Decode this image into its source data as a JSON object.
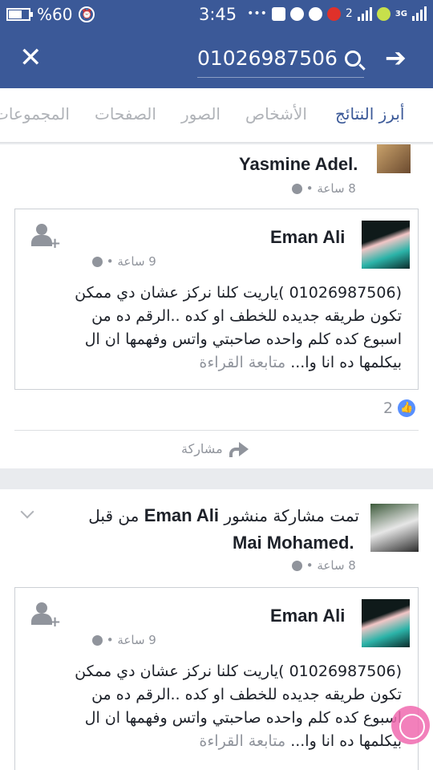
{
  "status_bar": {
    "battery": "%60",
    "time": "3:45",
    "network_type": "3G",
    "sim_label": "2"
  },
  "search": {
    "query": "01026987506"
  },
  "tabs": [
    {
      "label": "أبرز النتائج",
      "active": true
    },
    {
      "label": "الأشخاص",
      "active": false
    },
    {
      "label": "الصور",
      "active": false
    },
    {
      "label": "الصفحات",
      "active": false
    },
    {
      "label": "المجموعات",
      "active": false
    }
  ],
  "results": [
    {
      "author": "Yasmine Adel",
      "time": "8 ساعة",
      "shared_post": {
        "author": "Eman Ali",
        "time": "9 ساعة",
        "lines": [
          "(01026987506 )ياريت كلنا نركز عشان دي ممكن",
          "تكون طريقه جديده للخطف او كده ..الرقم ده من",
          "اسبوع كده كلم واحده صاحبتي واتس وفهمها ان ال"
        ],
        "last_line": "بيكلمها ده انا وا...",
        "see_more": "متابعة القراءة"
      },
      "likes": "2",
      "share_label": "مشاركة"
    },
    {
      "shared_label": "تمت مشاركة منشور",
      "original_author": "Eman Ali",
      "by_label": "من قبل",
      "author": "Mai Mohamed",
      "time": "8 ساعة",
      "shared_post": {
        "author": "Eman Ali",
        "time": "9 ساعة",
        "lines": [
          "(01026987506 )ياريت كلنا نركز عشان دي ممكن",
          "تكون طريقه جديده للخطف او كده ..الرقم ده من",
          "اسبوع كده كلم واحده صاحبتي واتس وفهمها ان ال"
        ],
        "last_line": "بيكلمها ده انا وا...",
        "see_more": "متابعة القراءة"
      }
    }
  ]
}
